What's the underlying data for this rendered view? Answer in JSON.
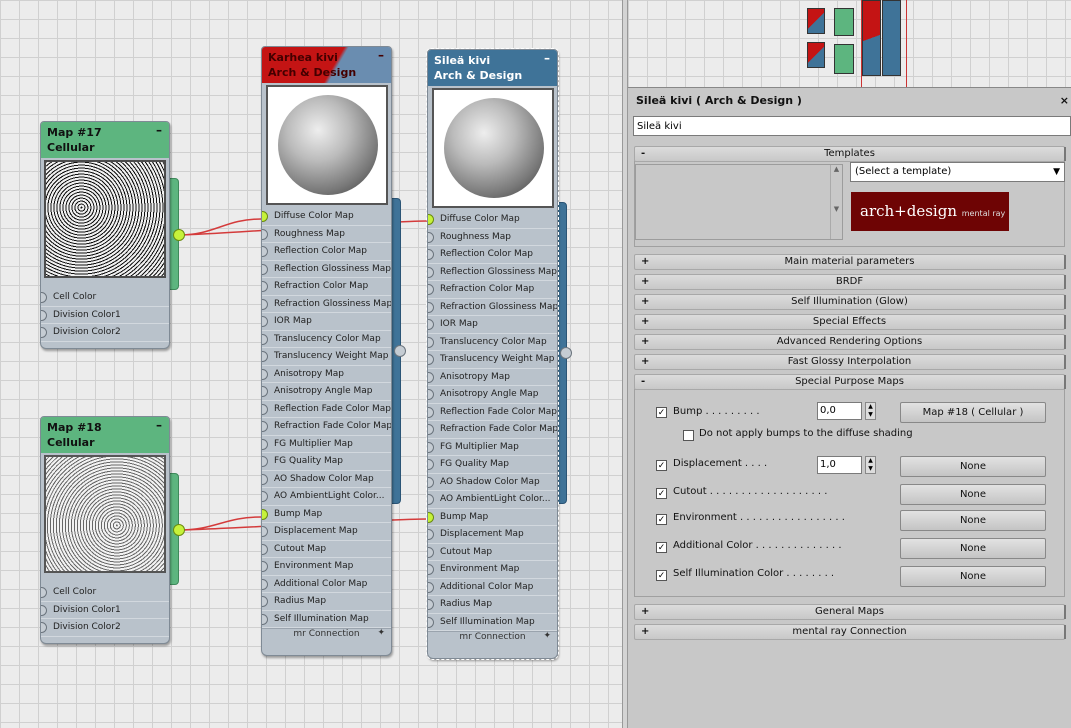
{
  "graph": {
    "map17": {
      "title1": "Map #17",
      "title2": "Cellular",
      "sockets": [
        "Cell Color",
        "Division Color1",
        "Division Color2"
      ]
    },
    "map18": {
      "title1": "Map #18",
      "title2": "Cellular",
      "sockets": [
        "Cell Color",
        "Division Color1",
        "Division Color2"
      ]
    },
    "karhea": {
      "title1": "Karhea kivi",
      "title2": "Arch & Design"
    },
    "silea": {
      "title1": "Sileä kivi",
      "title2": "Arch & Design"
    },
    "material_sockets": [
      "Diffuse Color Map",
      "Roughness Map",
      "Reflection Color Map",
      "Reflection Glossiness Map",
      "Refraction Color Map",
      "Refraction Glossiness Map",
      "IOR Map",
      "Translucency Color Map",
      "Translucency Weight Map",
      "Anisotropy Map",
      "Anisotropy Angle Map",
      "Reflection Fade Color Map",
      "Refraction Fade Color Map",
      "FG Multiplier Map",
      "FG Quality Map",
      "AO Shadow Color Map",
      "AO AmbientLight Color...",
      "Bump Map",
      "Displacement Map",
      "Cutout Map",
      "Environment Map",
      "Additional Color Map",
      "Radius Map",
      "Self Illumination Map"
    ],
    "footer": "mr Connection",
    "minimize_glyph": "–"
  },
  "panel": {
    "title": "Sileä kivi  ( Arch & Design )",
    "close": "×",
    "name_value": "Sileä kivi",
    "templates": {
      "label": "Templates",
      "sign": "-",
      "select": "(Select a template)",
      "logo": "arch+design",
      "logo_sub": "mental ray"
    },
    "rollouts_top": [
      "Main material parameters",
      "BRDF",
      "Self Illumination (Glow)",
      "Special Effects",
      "Advanced Rendering Options",
      "Fast Glossy Interpolation"
    ],
    "special": {
      "label": "Special Purpose Maps",
      "bump": {
        "label": "Bump  . . . . . . . . .",
        "value": "0,0",
        "button": "Map #18  ( Cellular )"
      },
      "no_diffuse": "Do not apply bumps to the diffuse shading",
      "displacement": {
        "label": "Displacement  . . . .",
        "value": "1,0",
        "button": "None"
      },
      "rows": [
        {
          "label": "Cutout  . . . . . . . . . . . . . . . . . . .",
          "button": "None"
        },
        {
          "label": "Environment  . . . . . . . . . . . . . . . . .",
          "button": "None"
        },
        {
          "label": "Additional Color  . . . . . . . . . . . . . .",
          "button": "None"
        },
        {
          "label": "Self Illumination Color  . . . . . . . .",
          "button": "None"
        }
      ]
    },
    "rollouts_bottom": [
      "General Maps",
      "mental ray Connection"
    ],
    "plus": "+",
    "minus": "-",
    "check": "✓"
  }
}
